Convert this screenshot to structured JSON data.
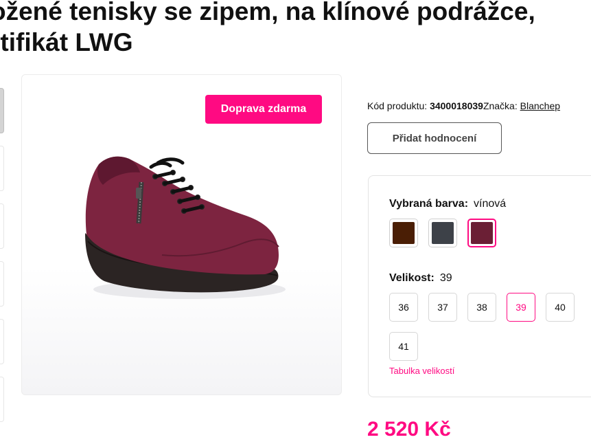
{
  "product": {
    "title_line1": "ožené tenisky se zipem, na klínové podrážce,",
    "title_line2": "rtifikát LWG",
    "code_label": "Kód produktu:",
    "code": "3400018039",
    "brand_label": "Značka:",
    "brand": "Blanchep",
    "badge": "Doprava zdarma",
    "rate_button": "Přidat hodnocení",
    "price": "2 520 Kč"
  },
  "color": {
    "label": "Vybraná barva:",
    "selected": "vínová",
    "swatches": [
      {
        "color": "#4a1e05",
        "selected": false
      },
      {
        "color": "#3d4148",
        "selected": false
      },
      {
        "color": "#6b1f35",
        "selected": true
      }
    ]
  },
  "size": {
    "label": "Velikost:",
    "selected": "39",
    "options": [
      "36",
      "37",
      "38",
      "39",
      "40",
      "41"
    ],
    "chart_link": "Tabulka velikostí"
  },
  "icons": {
    "product_image": "burgundy-wedge-sneaker-image"
  },
  "colors": {
    "accent": "#ff0a82"
  }
}
